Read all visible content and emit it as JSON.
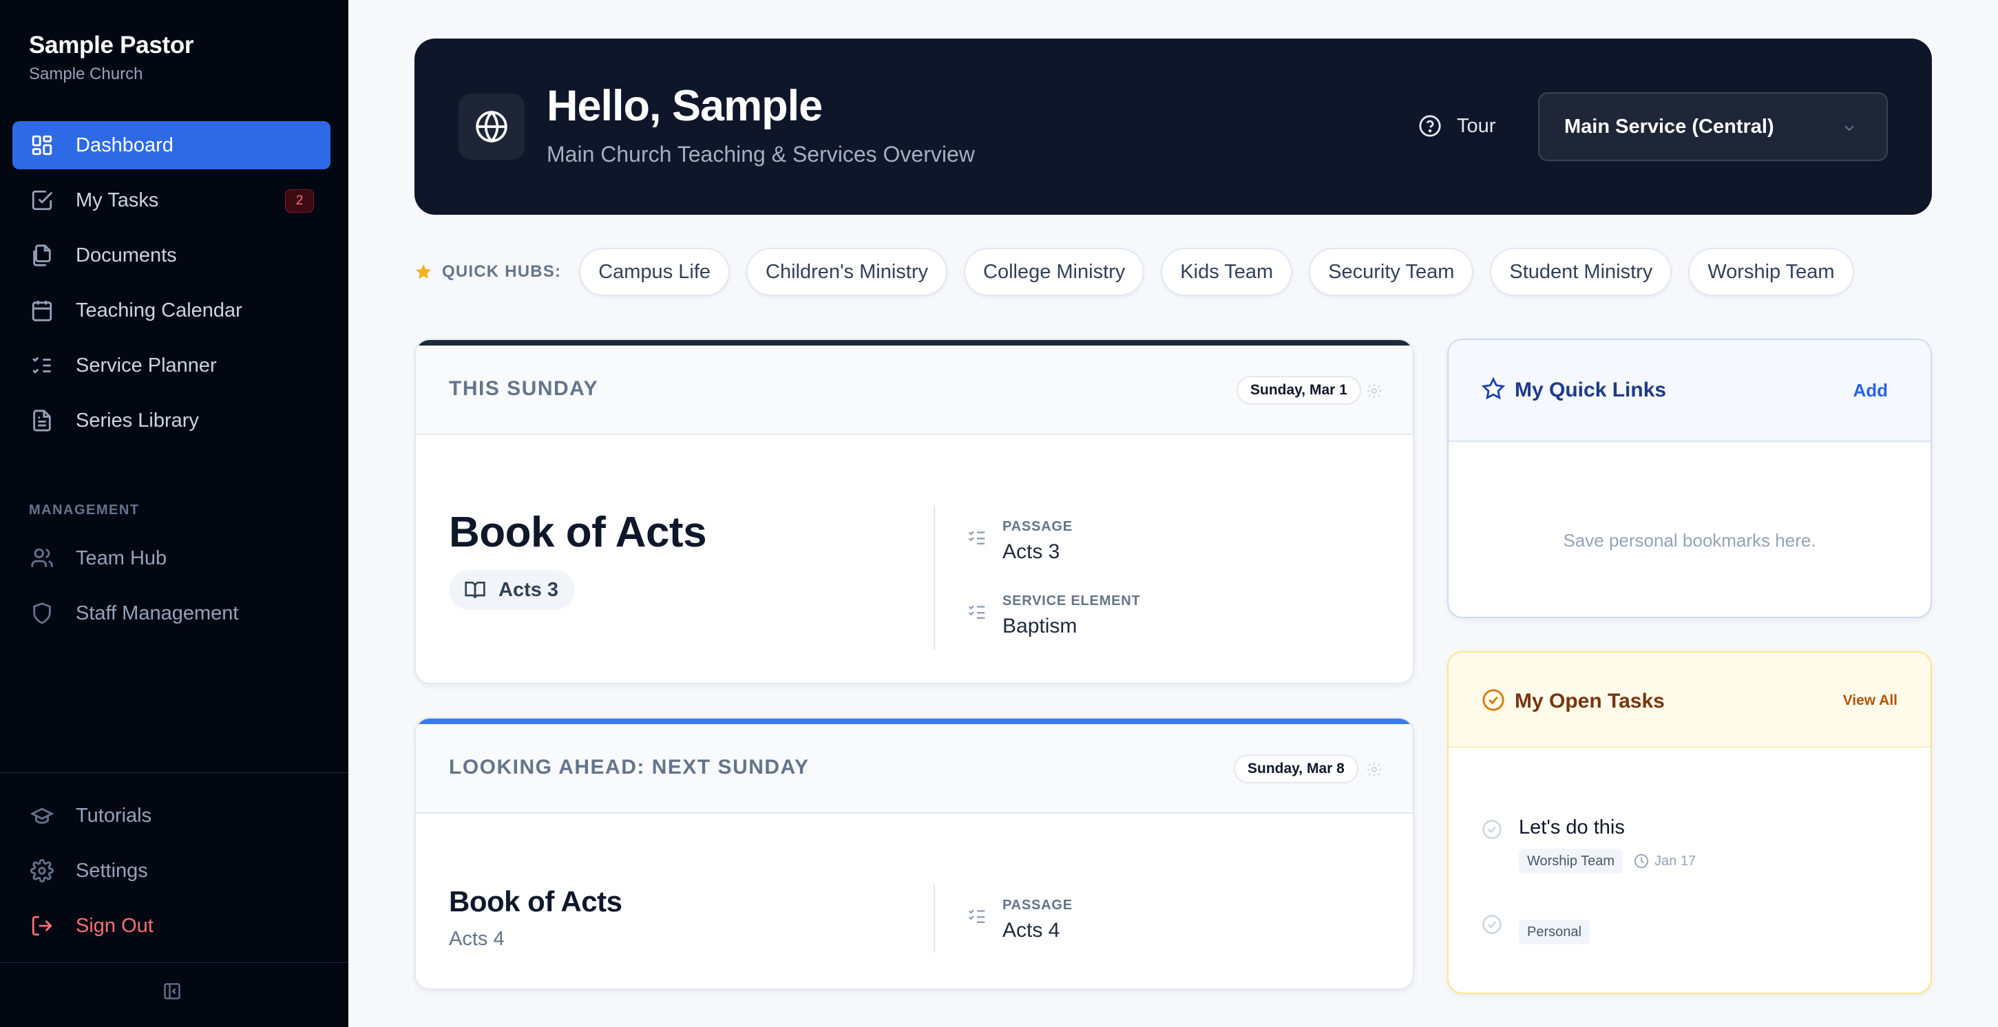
{
  "sidebar": {
    "brand_name": "Sample Pastor",
    "brand_sub": "Sample Church",
    "items": [
      {
        "label": "Dashboard",
        "icon": "dashboard-icon",
        "active": true
      },
      {
        "label": "My Tasks",
        "icon": "tasks-icon",
        "badge": "2"
      },
      {
        "label": "Documents",
        "icon": "documents-icon"
      },
      {
        "label": "Teaching Calendar",
        "icon": "calendar-icon"
      },
      {
        "label": "Service Planner",
        "icon": "planner-icon"
      },
      {
        "label": "Series Library",
        "icon": "library-icon"
      }
    ],
    "management_label": "MANAGEMENT",
    "management_items": [
      {
        "label": "Team Hub",
        "icon": "users-icon"
      },
      {
        "label": "Staff Management",
        "icon": "shield-icon"
      }
    ],
    "footer_items": [
      {
        "label": "Tutorials",
        "icon": "graduation-cap-icon"
      },
      {
        "label": "Settings",
        "icon": "gear-icon"
      },
      {
        "label": "Sign Out",
        "icon": "sign-out-icon"
      }
    ],
    "collapse_icon": "collapse-sidebar-icon"
  },
  "header": {
    "title": "Hello, Sample",
    "subtitle": "Main Church Teaching & Services Overview",
    "tour_label": "Tour",
    "service_selected": "Main Service (Central)"
  },
  "quick_hubs": {
    "label": "QUICK HUBS:",
    "hubs": [
      "Campus Life",
      "Children's Ministry",
      "College Ministry",
      "Kids Team",
      "Security Team",
      "Student Ministry",
      "Worship Team"
    ]
  },
  "this_sunday": {
    "label": "THIS SUNDAY",
    "date": "Sunday, Mar 1",
    "series": "Book of Acts",
    "chapter": "Acts 3",
    "passage_label": "PASSAGE",
    "passage_value": "Acts 3",
    "element_label": "SERVICE ELEMENT",
    "element_value": "Baptism"
  },
  "next_sunday": {
    "label": "LOOKING AHEAD: NEXT SUNDAY",
    "date": "Sunday, Mar 8",
    "series": "Book of Acts",
    "chapter": "Acts 4",
    "passage_label": "PASSAGE",
    "passage_value": "Acts 4"
  },
  "quick_links": {
    "title": "My Quick Links",
    "action": "Add",
    "empty": "Save personal bookmarks here."
  },
  "open_tasks": {
    "title": "My Open Tasks",
    "action": "View All",
    "tasks": [
      {
        "title": "Let's do this",
        "tag": "Worship Team",
        "due": "Jan 17"
      },
      {
        "title": "",
        "tag": "Personal",
        "due": ""
      }
    ]
  },
  "colors": {
    "sidebar_bg": "#030712",
    "accent": "#2f6ae6",
    "hero_bg": "#0f1629",
    "quick_links_accent": "#1e40af",
    "tasks_accent": "#b45309"
  }
}
